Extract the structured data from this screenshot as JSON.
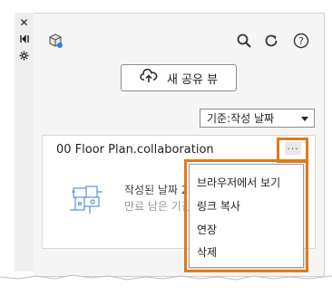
{
  "toolbar_strip": {
    "icons": [
      "close-icon",
      "collapse-icon",
      "settings-icon"
    ]
  },
  "header": {
    "icons": [
      "cube-share-icon",
      "search-icon",
      "refresh-icon",
      "help-icon"
    ],
    "help_glyph": "?"
  },
  "share_button": {
    "label": "새 공유 뷰"
  },
  "sort": {
    "selected": "기준:작성 날짜"
  },
  "card": {
    "title": "00 Floor Plan.collaboration",
    "created": "작성된 날짜 2",
    "expiry": "만료 남은 기긴",
    "more_glyph": "···"
  },
  "context_menu": {
    "items": [
      "브라우저에서 보기",
      "링크 복사",
      "연장",
      "삭제"
    ]
  },
  "highlight_color": "#e07a1a"
}
